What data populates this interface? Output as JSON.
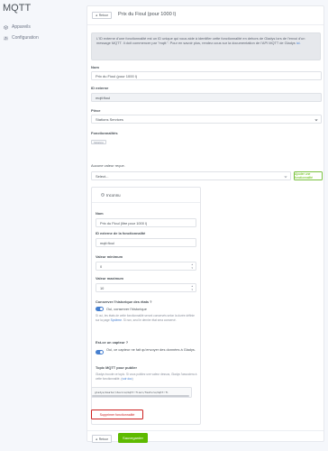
{
  "app": {
    "title": "MQTT"
  },
  "sidebar": {
    "items": [
      {
        "label": "Appareils",
        "icon": "box-icon"
      },
      {
        "label": "Configuration",
        "icon": "sliders-icon"
      }
    ]
  },
  "header": {
    "back_label": "Retour",
    "title": "Prix du Fioul (pour 1000 l)"
  },
  "alert": {
    "text": "L'ID externe d'une fonctionnalité est un ID unique qui vous aide à identifier cette fonctionnalité en dehors de Gladys lors de l'envoi d'un message MQTT. Il doit commencer par \"mqtt:\". Pour en savoir plus, rendez-vous sur la documentation de l'API MQTT de Gladys",
    "link": "ici."
  },
  "device": {
    "name_label": "Nom",
    "name_value": "Prix du Fioul (pour 1000 l)",
    "external_id_label": "ID externe",
    "external_id_value": "mqtt:fioul",
    "room_label": "Pièce",
    "room_value": "Stations Services",
    "features_label": "Fonctionnalités",
    "features_badge": "Inconnu"
  },
  "feature_add": {
    "label": "Aucune valeur reçue.",
    "select_placeholder": "Select...",
    "add_button": "Ajouter une fonctionnalité"
  },
  "feature": {
    "title": "Inconnu",
    "name_label": "Nom",
    "name_value": "Prix du Fioul (litre pour 1000 l)",
    "external_id_label": "ID externe de la fonctionnalité",
    "external_id_value": "mqtt:fioul",
    "min_label": "Valeur minimum",
    "min_value": "0",
    "max_label": "Valeur maximum",
    "max_value": "10",
    "history_label": "Conserver l'historique des états ?",
    "history_toggle_text": "Oui, conserver l'historique",
    "history_help": "Si oui, les états de cette fonctionnalité seront conservés selon la durée définie sur la page",
    "history_help_link": "Système",
    "history_help_tail": ". Si non, seul le dernier état sera conservé.",
    "sensor_label": "Est-ce un capteur ?",
    "sensor_toggle_text": "Oui, ce capteur ne fait qu'envoyer des données à Gladys.",
    "topic_label": "Topic MQTT pour publier",
    "topic_help": "Gladys écoute ce topic. Si vous publiez une valeur dessus, Gladys l'associera à cette fonctionnalité. (",
    "topic_help_link": "voir doc",
    "topic_help_tail": ")",
    "topic_value": "gladys/master/device/mqtt:fioul/feature/mqtt:fi",
    "delete_button": "Supprimer fonctionnalité"
  },
  "footer": {
    "back_label": "Retour",
    "save_label": "Sauvegarder"
  },
  "colors": {
    "primary": "#467fcf",
    "success": "#5eba00",
    "danger": "#cd201f"
  }
}
